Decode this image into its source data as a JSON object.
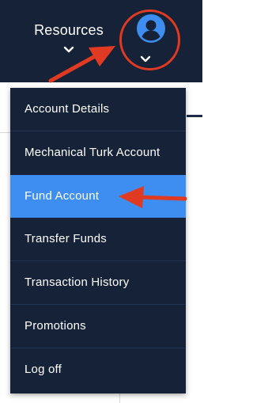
{
  "nav": {
    "resources_label": "Resources"
  },
  "menu": {
    "items": [
      {
        "label": "Account Details"
      },
      {
        "label": "Mechanical Turk Account"
      },
      {
        "label": "Fund Account",
        "active": true
      },
      {
        "label": "Transfer Funds"
      },
      {
        "label": "Transaction History"
      },
      {
        "label": "Promotions"
      },
      {
        "label": "Log off"
      }
    ]
  },
  "colors": {
    "nav_background": "#152238",
    "menu_active": "#3d8ef0",
    "avatar": "#3d8ef0",
    "annotation": "#e03a22"
  },
  "icons": {
    "account": "user-circle-icon",
    "expand": "chevron-down-icon"
  }
}
